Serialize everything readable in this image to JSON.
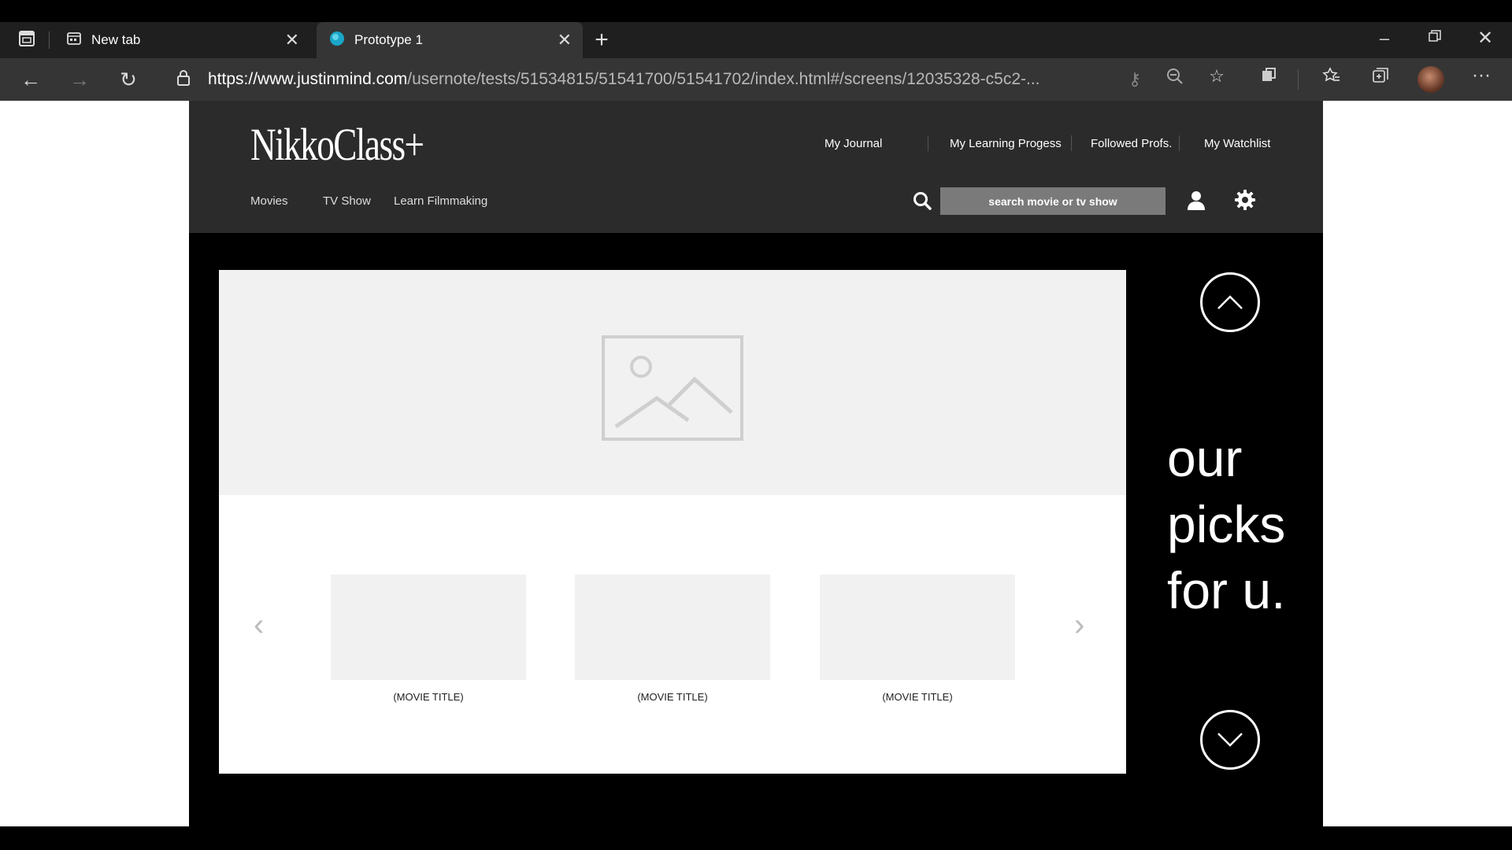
{
  "browser": {
    "tabs": [
      {
        "label": "New tab",
        "icon": "new-tab-page-icon"
      },
      {
        "label": "Prototype 1",
        "icon": "justinmind-favicon",
        "active": true
      }
    ],
    "url_host": "https://www.justinmind.com",
    "url_path": "/usernote/tests/51534815/51541700/51541702/index.html#/screens/12035328-c5c2-..."
  },
  "app": {
    "logo": "NikkoClass+",
    "top_nav": [
      "My Journal",
      "My Learning Progess",
      "Followed Profs.",
      "My Watchlist"
    ],
    "sub_nav": [
      "Movies",
      "TV Show",
      "Learn Filmmaking"
    ],
    "search_placeholder": "search movie or tv show"
  },
  "hero": {
    "movies": [
      "(MOVIE TITLE)",
      "(MOVIE TITLE)",
      "(MOVIE TITLE)"
    ]
  },
  "side_rail": {
    "picks_lines": [
      "our",
      "picks",
      "for u."
    ]
  },
  "colors": {
    "header_bg": "#2b2b2b",
    "page_bg": "#000000",
    "placeholder_gray": "#f1f1f1",
    "search_bg": "#7a7a7a"
  }
}
